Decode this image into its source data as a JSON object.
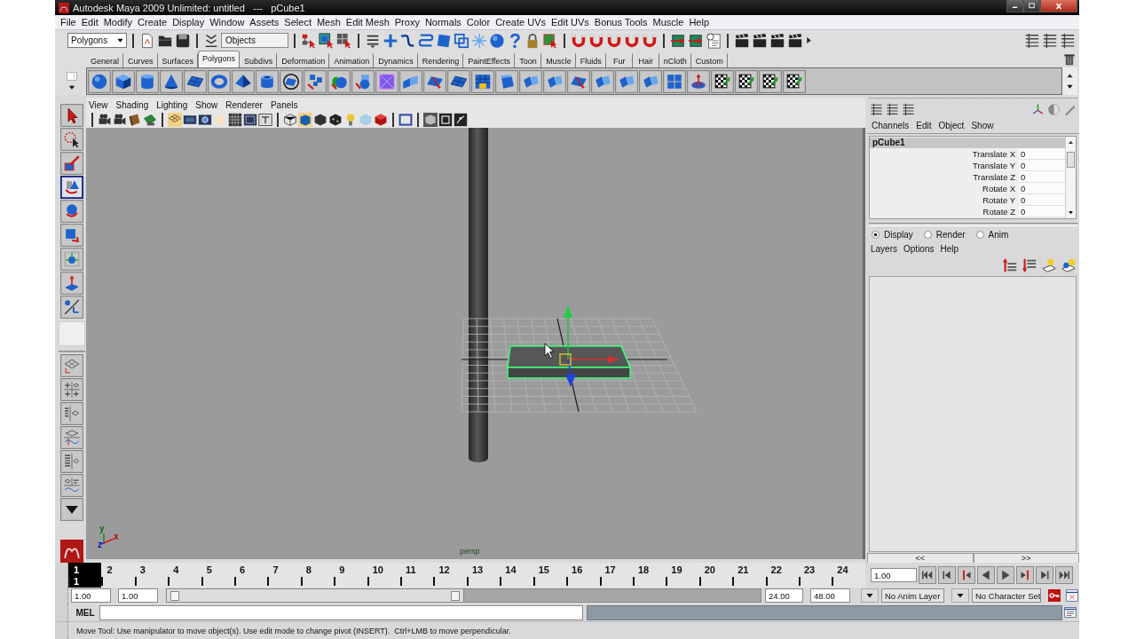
{
  "window": {
    "title": "Autodesk Maya 2009 Unlimited: untitled   ---   pCube1"
  },
  "menu_bar": [
    "File",
    "Edit",
    "Modify",
    "Create",
    "Display",
    "Window",
    "Assets",
    "Select",
    "Mesh",
    "Edit Mesh",
    "Proxy",
    "Normals",
    "Color",
    "Create UVs",
    "Edit UVs",
    "Bonus Tools",
    "Muscle",
    "Help"
  ],
  "status_line": {
    "menu_set": "Polygons",
    "selection_mode": "Objects"
  },
  "shelf": {
    "tabs": [
      {
        "label": "General",
        "selected": false
      },
      {
        "label": "Curves",
        "selected": false
      },
      {
        "label": "Surfaces",
        "selected": false
      },
      {
        "label": "Polygons",
        "selected": true
      },
      {
        "label": "Subdivs",
        "selected": false
      },
      {
        "label": "Deformation",
        "selected": false
      },
      {
        "label": "Animation",
        "selected": false
      },
      {
        "label": "Dynamics",
        "selected": false
      },
      {
        "label": "Rendering",
        "selected": false
      },
      {
        "label": "PaintEffects",
        "selected": false
      },
      {
        "label": "Toon",
        "selected": false
      },
      {
        "label": "Muscle",
        "selected": false
      },
      {
        "label": "Fluids",
        "selected": false
      },
      {
        "label": "Fur",
        "selected": false
      },
      {
        "label": "Hair",
        "selected": false
      },
      {
        "label": "nCloth",
        "selected": false
      },
      {
        "label": "Custom",
        "selected": false
      }
    ]
  },
  "tool_box": {
    "tools": [
      {
        "selected": false
      },
      {
        "selected": false
      },
      {
        "selected": false
      },
      {
        "selected": true
      },
      {
        "selected": false
      },
      {
        "selected": false
      },
      {
        "selected": false
      },
      {
        "selected": false
      },
      {
        "selected": false
      }
    ]
  },
  "viewport": {
    "menu": [
      "View",
      "Shading",
      "Lighting",
      "Show",
      "Renderer",
      "Panels"
    ],
    "axis_labels": [
      "y",
      "x",
      "z"
    ],
    "camera_label": "persp"
  },
  "channel_box": {
    "menu": [
      "Channels",
      "Edit",
      "Object",
      "Show"
    ],
    "object": "pCube1",
    "attributes": [
      {
        "name": "Translate X",
        "value": "0"
      },
      {
        "name": "Translate Y",
        "value": "0"
      },
      {
        "name": "Translate Z",
        "value": "0"
      },
      {
        "name": "Rotate X",
        "value": "0"
      },
      {
        "name": "Rotate Y",
        "value": "0"
      },
      {
        "name": "Rotate Z",
        "value": "0"
      }
    ]
  },
  "layer_editor": {
    "modes": [
      {
        "label": "Display",
        "selected": true
      },
      {
        "label": "Render",
        "selected": false
      },
      {
        "label": "Anim",
        "selected": false
      }
    ],
    "menu": [
      "Layers",
      "Options",
      "Help"
    ]
  },
  "panel_toggles": [
    "<<",
    ">>"
  ],
  "time_slider": {
    "frames": [
      {
        "label": "1",
        "selected": true
      },
      {
        "label": "2",
        "selected": false
      },
      {
        "label": "3",
        "selected": false
      },
      {
        "label": "4",
        "selected": false
      },
      {
        "label": "5",
        "selected": false
      },
      {
        "label": "6",
        "selected": false
      },
      {
        "label": "7",
        "selected": false
      },
      {
        "label": "8",
        "selected": false
      },
      {
        "label": "9",
        "selected": false
      },
      {
        "label": "10",
        "selected": false
      },
      {
        "label": "11",
        "selected": false
      },
      {
        "label": "12",
        "selected": false
      },
      {
        "label": "13",
        "selected": false
      },
      {
        "label": "14",
        "selected": false
      },
      {
        "label": "15",
        "selected": false
      },
      {
        "label": "16",
        "selected": false
      },
      {
        "label": "17",
        "selected": false
      },
      {
        "label": "18",
        "selected": false
      },
      {
        "label": "19",
        "selected": false
      },
      {
        "label": "20",
        "selected": false
      },
      {
        "label": "21",
        "selected": false
      },
      {
        "label": "22",
        "selected": false
      },
      {
        "label": "23",
        "selected": false
      },
      {
        "label": "24",
        "selected": false
      }
    ],
    "current_frame": "1",
    "current_time": "1.00"
  },
  "range_slider": {
    "start_time": "1.00",
    "playback_start": "1.00",
    "level": 0.5,
    "playback_end": "24.00",
    "end_time": "48.00",
    "anim_layer": "No Anim Layer",
    "character_set": "No Character Set"
  },
  "command_line": {
    "language": "MEL"
  },
  "help_line": "Move Tool: Use manipulator to move object(s). Use edit mode to change pivot (INSERT).  Ctrl+LMB to move perpendicular."
}
